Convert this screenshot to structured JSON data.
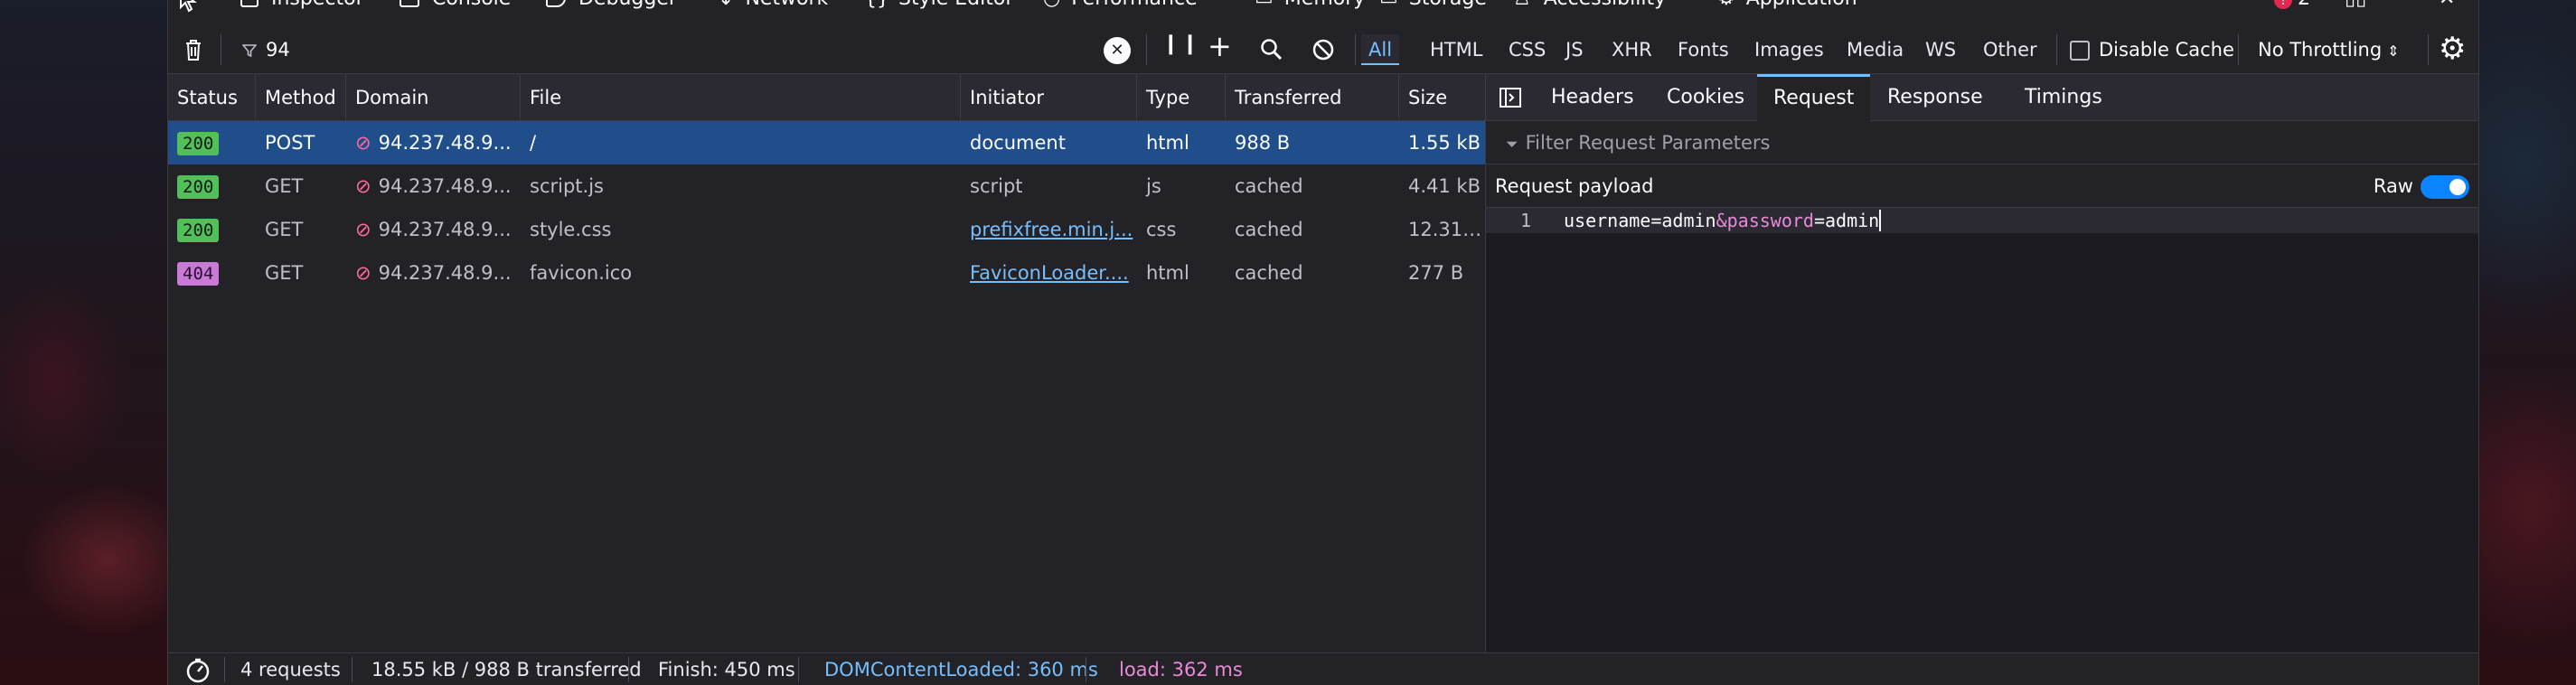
{
  "devtools_tabs": [
    {
      "label": "Inspector"
    },
    {
      "label": "Console"
    },
    {
      "label": "Debugger"
    },
    {
      "label": "Network"
    },
    {
      "label": "Style Editor"
    },
    {
      "label": "Performance"
    },
    {
      "label": "Memory"
    },
    {
      "label": "Storage"
    },
    {
      "label": "Accessibility"
    },
    {
      "label": "Application"
    }
  ],
  "error_count": "2",
  "toolbar": {
    "filter_value": "94",
    "type_filters": [
      "All",
      "HTML",
      "CSS",
      "JS",
      "XHR",
      "Fonts",
      "Images",
      "Media",
      "WS",
      "Other"
    ],
    "active_filter": "All",
    "disable_cache_label": "Disable Cache",
    "throttling_label": "No Throttling"
  },
  "columns": [
    "Status",
    "Method",
    "Domain",
    "File",
    "Initiator",
    "Type",
    "Transferred",
    "Size"
  ],
  "requests": [
    {
      "status": "200",
      "method": "POST",
      "domain": "94.237.48.9...",
      "file": "/",
      "initiator": "document",
      "type": "html",
      "transferred": "988 B",
      "size": "1.55 kB",
      "selected": true
    },
    {
      "status": "200",
      "method": "GET",
      "domain": "94.237.48.9...",
      "file": "script.js",
      "initiator": "script",
      "type": "js",
      "transferred": "cached",
      "size": "4.41 kB"
    },
    {
      "status": "200",
      "method": "GET",
      "domain": "94.237.48.9...",
      "file": "style.css",
      "initiator": "prefixfree.min.j...",
      "type": "css",
      "transferred": "cached",
      "size": "12.31 ..."
    },
    {
      "status": "404",
      "method": "GET",
      "domain": "94.237.48.9...",
      "file": "favicon.ico",
      "initiator": "FaviconLoader....",
      "type": "html",
      "transferred": "cached",
      "size": "277 B"
    }
  ],
  "side_panel": {
    "tabs": [
      "Headers",
      "Cookies",
      "Request",
      "Response",
      "Timings"
    ],
    "active_tab": "Request",
    "filter_placeholder": "Filter Request Parameters",
    "payload_label": "Request payload",
    "raw_label": "Raw",
    "raw_enabled": true,
    "line_number": "1",
    "payload": {
      "part1": "username=admin",
      "part2": "&password",
      "part3": "=admin"
    }
  },
  "status_bar": {
    "requests": "4 requests",
    "size": "18.55 kB / 988 B transferred",
    "finish": "Finish: 450 ms",
    "dom": "DOMContentLoaded: 360 ms",
    "load": "load: 362 ms"
  },
  "colors": {
    "accent": "#75bfff",
    "selected_row": "#204e8a",
    "ok_badge": "#51c05a",
    "notfound_badge": "#c87ad6",
    "load": "#e88ad8",
    "dom": "#75bfff"
  }
}
